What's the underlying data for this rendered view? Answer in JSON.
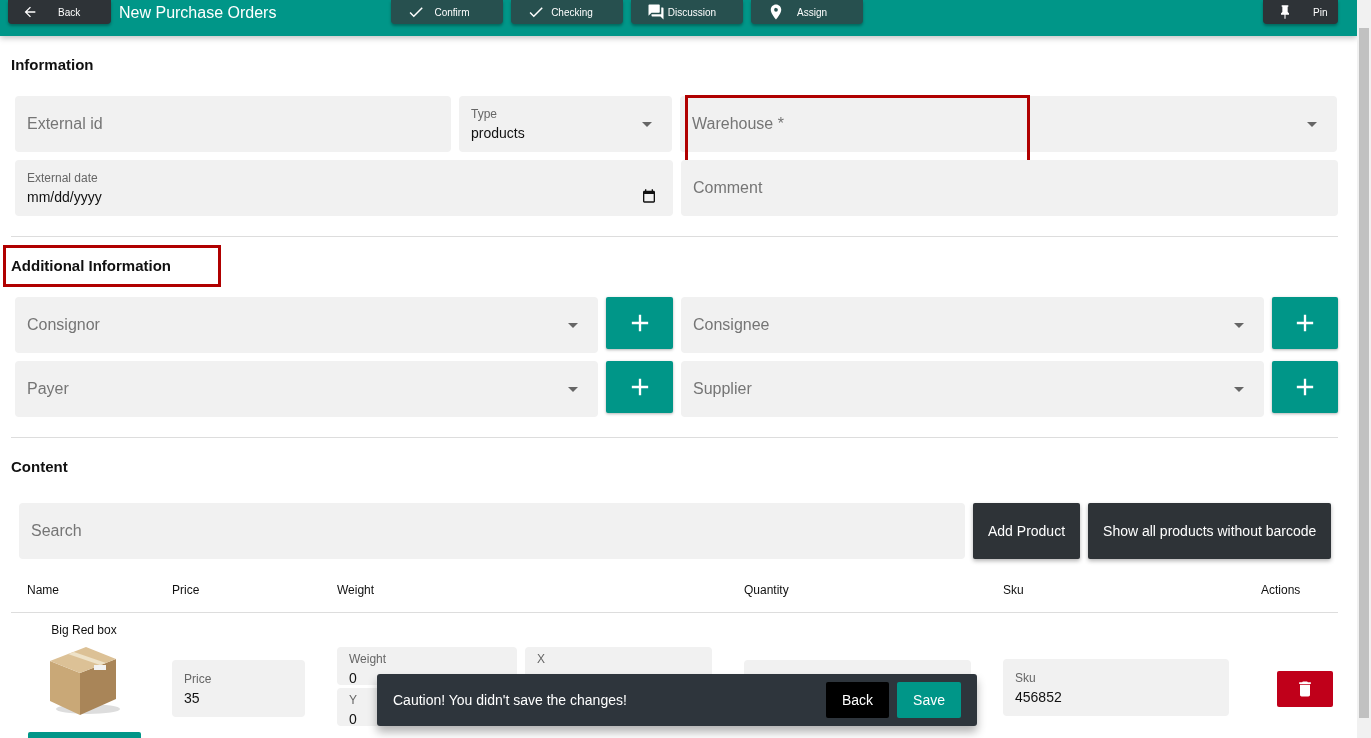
{
  "header": {
    "back_button": "Back",
    "title": "New Purchase Orders",
    "actions": [
      {
        "label": "Confirm",
        "kind": "check"
      },
      {
        "label": "Checking",
        "kind": "check"
      },
      {
        "label": "Discussion",
        "kind": "comment"
      },
      {
        "label": "Assign",
        "kind": "location"
      }
    ],
    "pin_button": "Pin"
  },
  "information": {
    "heading": "Information",
    "external_id": {
      "placeholder": "External id"
    },
    "type": {
      "label": "Type",
      "value": "products"
    },
    "warehouse": {
      "placeholder": "Warehouse *",
      "highlighted": true
    },
    "external_date": {
      "label": "External date",
      "placeholder": "mm/dd/yyyy"
    },
    "comment": {
      "placeholder": "Comment"
    }
  },
  "additional": {
    "heading": "Additional Information",
    "highlighted": true,
    "fields": [
      {
        "placeholder": "Consignor"
      },
      {
        "placeholder": "Consignee"
      },
      {
        "placeholder": "Payer"
      },
      {
        "placeholder": "Supplier"
      }
    ]
  },
  "content": {
    "heading": "Content",
    "search": {
      "placeholder": "Search"
    },
    "buttons": [
      "Add Product",
      "Show all products without barcode"
    ],
    "table": {
      "columns": [
        "Name",
        "Price",
        "Weight",
        "Quantity",
        "Sku",
        "Actions"
      ],
      "rows": [
        {
          "name": "Big Red box",
          "price": {
            "label": "Price",
            "value": "35"
          },
          "weight": {
            "label": "Weight",
            "value": "0"
          },
          "x": {
            "label": "X"
          },
          "y": {
            "label": "Y",
            "value": "0"
          },
          "sku": {
            "label": "Sku",
            "value": "456852"
          }
        }
      ]
    }
  },
  "snackbar": {
    "message": "Caution! You didn't save the changes!",
    "buttons": [
      "Back",
      "Save"
    ]
  }
}
